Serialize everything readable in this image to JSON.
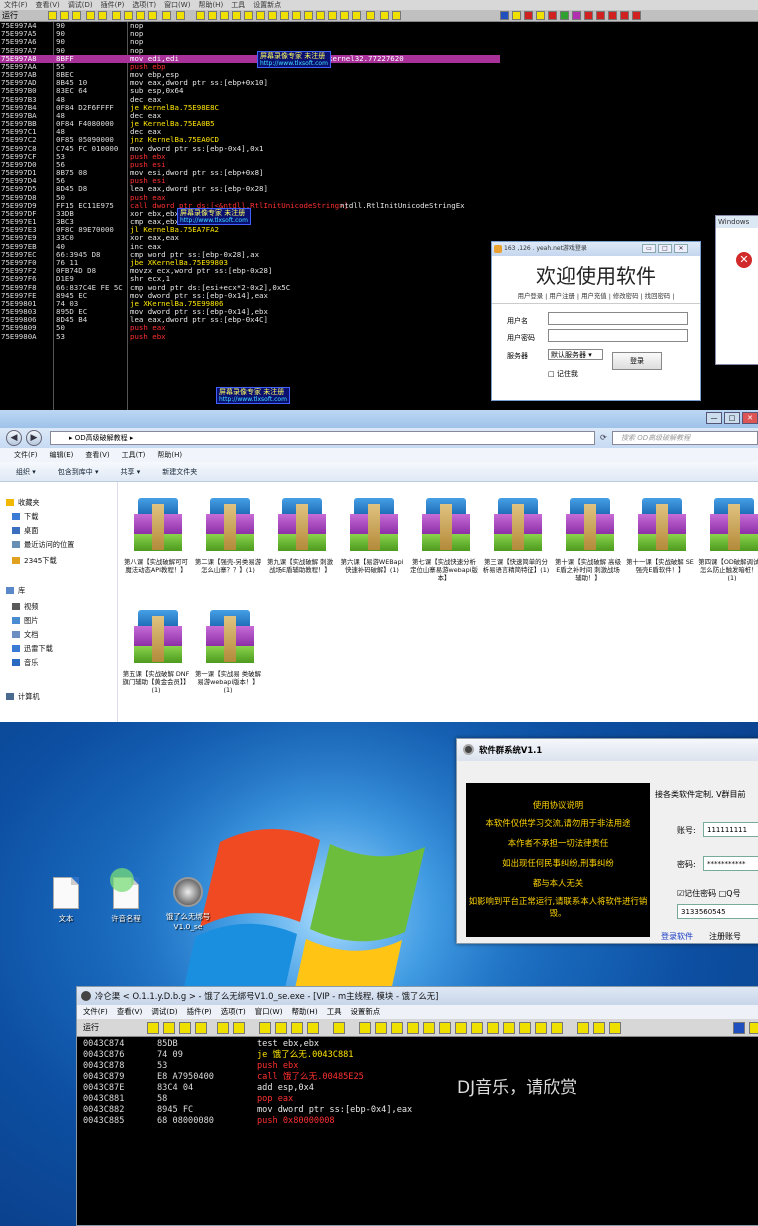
{
  "debugger1": {
    "menu": [
      "文件(F)",
      "查看(V)",
      "调试(D)",
      "插件(P)",
      "选项(T)",
      "窗口(W)",
      "帮助(H)",
      "工具",
      "设置新点"
    ],
    "run_label": "运行",
    "rows": [
      {
        "addr": "75E997A4",
        "hex": "90",
        "asm": "nop",
        "cmt": "",
        "kind": ""
      },
      {
        "addr": "75E997A5",
        "hex": "90",
        "asm": "nop",
        "cmt": "",
        "kind": ""
      },
      {
        "addr": "75E997A6",
        "hex": "90",
        "asm": "nop",
        "cmt": "",
        "kind": ""
      },
      {
        "addr": "75E997A7",
        "hex": "90",
        "asm": "nop",
        "cmt": "",
        "kind": ""
      },
      {
        "addr": "75E997A8",
        "hex": "8BFF",
        "asm": "mov edi,edi",
        "cmt": "kernel32.77227620",
        "kind": "sel"
      },
      {
        "addr": "75E997AA",
        "hex": "55",
        "asm": "push ebp",
        "cmt": "",
        "kind": "push"
      },
      {
        "addr": "75E997AB",
        "hex": "8BEC",
        "asm": "mov ebp,esp",
        "cmt": "",
        "kind": ""
      },
      {
        "addr": "75E997AD",
        "hex": "8B45 10",
        "asm": "mov eax,dword ptr ss:[ebp+0x10]",
        "cmt": "",
        "kind": ""
      },
      {
        "addr": "75E997B0",
        "hex": "83EC 64",
        "asm": "sub esp,0x64",
        "cmt": "",
        "kind": ""
      },
      {
        "addr": "75E997B3",
        "hex": "48",
        "asm": "dec eax",
        "cmt": "",
        "kind": ""
      },
      {
        "addr": "75E997B4",
        "hex": "0F84 D2F6FFFF",
        "asm": "je KernelBa.75E98E8C",
        "cmt": "",
        "kind": "jmp"
      },
      {
        "addr": "75E997BA",
        "hex": "48",
        "asm": "dec eax",
        "cmt": "",
        "kind": ""
      },
      {
        "addr": "75E997BB",
        "hex": "0F84 F4080000",
        "asm": "je KernelBa.75EA0B5",
        "cmt": "",
        "kind": "jmp"
      },
      {
        "addr": "75E997C1",
        "hex": "48",
        "asm": "dec eax",
        "cmt": "",
        "kind": ""
      },
      {
        "addr": "75E997C2",
        "hex": "0F85 05090000",
        "asm": "jnz KernelBa.75EA0CD",
        "cmt": "",
        "kind": "jmp"
      },
      {
        "addr": "75E997C8",
        "hex": "C745 FC 010000",
        "asm": "mov dword ptr ss:[ebp-0x4],0x1",
        "cmt": "",
        "kind": ""
      },
      {
        "addr": "75E997CF",
        "hex": "53",
        "asm": "push ebx",
        "cmt": "",
        "kind": "push"
      },
      {
        "addr": "75E997D0",
        "hex": "56",
        "asm": "push esi",
        "cmt": "",
        "kind": "push"
      },
      {
        "addr": "75E997D1",
        "hex": "8B75 08",
        "asm": "mov esi,dword ptr ss:[ebp+0x8]",
        "cmt": "",
        "kind": ""
      },
      {
        "addr": "75E997D4",
        "hex": "56",
        "asm": "push esi",
        "cmt": "",
        "kind": "push"
      },
      {
        "addr": "75E997D5",
        "hex": "8D45 D8",
        "asm": "lea eax,dword ptr ss:[ebp-0x28]",
        "cmt": "",
        "kind": ""
      },
      {
        "addr": "75E997D8",
        "hex": "50",
        "asm": "push eax",
        "cmt": "",
        "kind": "push"
      },
      {
        "addr": "75E997D9",
        "hex": "FF15 EC11E975",
        "asm": "call dword ptr ds:[<&ntdll.RtlInitUnicodeString>]",
        "cmt": "ntdll.RtlInitUnicodeStringEx",
        "kind": "call"
      },
      {
        "addr": "75E997DF",
        "hex": "33DB",
        "asm": "xor ebx,ebx",
        "cmt": "",
        "kind": ""
      },
      {
        "addr": "75E997E1",
        "hex": "3BC3",
        "asm": "cmp eax,ebx",
        "cmt": "",
        "kind": ""
      },
      {
        "addr": "75E997E3",
        "hex": "0F8C 89E70000",
        "asm": "jl KernelBa.75EA7FA2",
        "cmt": "",
        "kind": "jmp"
      },
      {
        "addr": "75E997E9",
        "hex": "33C0",
        "asm": "xor eax,eax",
        "cmt": "",
        "kind": ""
      },
      {
        "addr": "75E997EB",
        "hex": "40",
        "asm": "inc eax",
        "cmt": "",
        "kind": ""
      },
      {
        "addr": "75E997EC",
        "hex": "66:3945 D8",
        "asm": "cmp word ptr ss:[ebp-0x28],ax",
        "cmt": "",
        "kind": ""
      },
      {
        "addr": "75E997F0",
        "hex": "76 11",
        "asm": "jbe XKernelBa.75E99803",
        "cmt": "",
        "kind": "jmp"
      },
      {
        "addr": "75E997F2",
        "hex": "0FB74D D8",
        "asm": "movzx ecx,word ptr ss:[ebp-0x28]",
        "cmt": "",
        "kind": ""
      },
      {
        "addr": "75E997F6",
        "hex": "D1E9",
        "asm": "shr ecx,1",
        "cmt": "",
        "kind": ""
      },
      {
        "addr": "75E997F8",
        "hex": "66:837C4E FE 5C",
        "asm": "cmp word ptr ds:[esi+ecx*2-0x2],0x5C",
        "cmt": "",
        "kind": ""
      },
      {
        "addr": "75E997FE",
        "hex": "8945 EC",
        "asm": "mov dword ptr ss:[ebp-0x14],eax",
        "cmt": "",
        "kind": ""
      },
      {
        "addr": "75E99801",
        "hex": "74 03",
        "asm": "je XKernelBa.75E99806",
        "cmt": "",
        "kind": "jmp"
      },
      {
        "addr": "75E99803",
        "hex": "895D EC",
        "asm": "mov dword ptr ss:[ebp-0x14],ebx",
        "cmt": "",
        "kind": ""
      },
      {
        "addr": "75E99806",
        "hex": "8D45 B4",
        "asm": "lea eax,dword ptr ss:[ebp-0x4C]",
        "cmt": "",
        "kind": ""
      },
      {
        "addr": "75E99809",
        "hex": "50",
        "asm": "push eax",
        "cmt": "",
        "kind": "push"
      },
      {
        "addr": "75E9980A",
        "hex": "53",
        "asm": "push ebx",
        "cmt": "",
        "kind": "push"
      }
    ],
    "watermark_l1": "屏幕录像专家      未注册",
    "watermark_l2": "http://www.tlxsoft.com"
  },
  "login_dialog": {
    "title": "163 ,126 . yeah.net游戏登录",
    "heading": "欢迎使用软件",
    "links": "用户登录 | 用户注册 | 用户充值 | 修改密码 | 找回密码 |",
    "username_label": "用户名",
    "password_label": "用户密码",
    "server_label": "服务器",
    "server_value": "默认服务器",
    "login_button": "登录",
    "remember_label": "记住我"
  },
  "win_error": {
    "title": "Windows"
  },
  "explorer": {
    "path": "OD高级破解教程",
    "search_placeholder": "搜索 OD高级破解教程",
    "menu": [
      "文件(F)",
      "编辑(E)",
      "查看(V)",
      "工具(T)",
      "帮助(H)"
    ],
    "commands": [
      "组织 ▾",
      "包含到库中 ▾",
      "共享 ▾",
      "新建文件夹"
    ],
    "nav": [
      {
        "label": "收藏夹",
        "color": "#f0b800"
      },
      {
        "label": "下载",
        "color": "#3a7bd5"
      },
      {
        "label": "桌面",
        "color": "#3a6fc0"
      },
      {
        "label": "最近访问的位置",
        "color": "#6a8fb5"
      },
      {
        "label": "2345下载",
        "color": "#e0a020"
      },
      {
        "label": "库",
        "color": "#5a88c8"
      },
      {
        "label": "视频",
        "color": "#5a5a5a"
      },
      {
        "label": "图片",
        "color": "#4a8ad0"
      },
      {
        "label": "文档",
        "color": "#6b8fc0"
      },
      {
        "label": "迅雷下载",
        "color": "#3a7ad5"
      },
      {
        "label": "音乐",
        "color": "#2a6ac0"
      },
      {
        "label": "计算机",
        "color": "#4a6a90"
      }
    ],
    "files": [
      "第八课【实战破解可可魔法动态API教程！】",
      "第二课【强壳-另类易游怎么山寨？？】(1)",
      "第九课【实战破解 刺激战场E盾辅助教程！】",
      "第六课【易游WEBapi快速补码破解】(1)",
      "第七课【实战快速分析定位山寨易游webapi版本】",
      "第三课【快速简单的分析易语言精简特征】(1)",
      "第十课【实战破解 高级E盾之补时间 刺激战场辅助！】",
      "第十一课【实战破解 SE强壳E盾软件！】",
      "第四课【OD破解调试时怎么防止触发暗桩！】(1)",
      "第五课【实战破解 DNF 旗门辅助【黄金会员】】(1)",
      "第一课【实战易 类破解易游webapi版本！】(1)"
    ]
  },
  "desktop": {
    "icons": [
      "文本",
      "许音名程",
      "饿了么无绑号V1.0_se"
    ],
    "soft_window": {
      "title": "软件群系统V1.1",
      "notice": [
        "使用协议说明",
        "本软件仅供学习交流,请勿用于非法用途",
        "本作者不承担一切法律责任",
        "如出现任何民事纠纷,刑事纠纷",
        "都与本人无关",
        "如影响到平台正常运行,请联系本人将软件进行销毁。"
      ],
      "top_text": "接各类软件定制, V群目前",
      "account_label": "账号:",
      "account_value": "111111111",
      "password_label": "密码:",
      "password_value": "***********",
      "remember_label": "☑记住密码 □Q号",
      "qq_value": "3133560545",
      "login_link": "登录软件",
      "register_link": "注册账号"
    }
  },
  "debugger2": {
    "title": "冷仑渠 < O.1.1.y.D.b.g > - 饿了么无绑号V1.0_se.exe - [VIP - m主线程, 模块 - 饿了么无]",
    "menu": [
      "文件(F)",
      "查看(V)",
      "调试(D)",
      "插件(P)",
      "选项(T)",
      "窗口(W)",
      "帮助(H)",
      "工具",
      "设置新点"
    ],
    "run_label": "运行",
    "rows": [
      {
        "addr": "0043C874",
        "hex": "85DB",
        "asm": "test ebx,ebx",
        "kind": ""
      },
      {
        "addr": "0043C876",
        "hex": "74 09",
        "asm": "je 饿了么无.0043C881",
        "kind": "jmp"
      },
      {
        "addr": "0043C878",
        "hex": "53",
        "asm": "push ebx",
        "kind": "push"
      },
      {
        "addr": "0043C879",
        "hex": "E8 A7950400",
        "asm": "call 饿了么无.00485E25",
        "kind": "call"
      },
      {
        "addr": "0043C87E",
        "hex": "83C4 04",
        "asm": "add esp,0x4",
        "kind": ""
      },
      {
        "addr": "0043C881",
        "hex": "58",
        "asm": "pop eax",
        "kind": "push"
      },
      {
        "addr": "0043C882",
        "hex": "8945 FC",
        "asm": "mov dword ptr ss:[ebp-0x4],eax",
        "kind": ""
      },
      {
        "addr": "0043C885",
        "hex": "68 08000080",
        "asm": "push 0x80000008",
        "kind": "push"
      }
    ],
    "overlay_text": "DJ音乐，请欣赏"
  }
}
